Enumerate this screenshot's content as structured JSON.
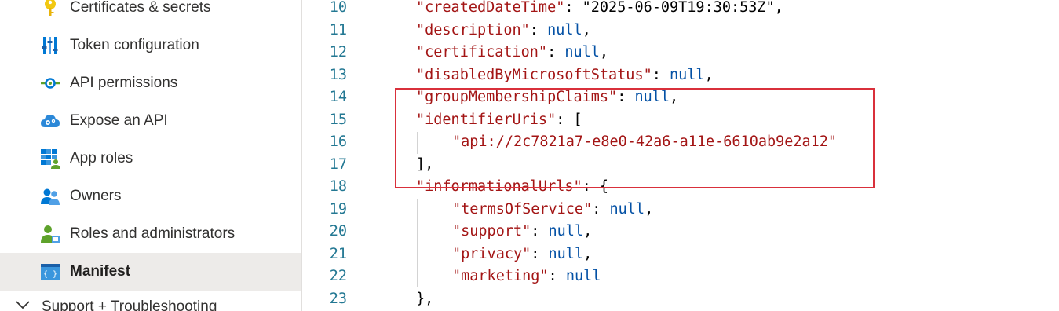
{
  "sidebar": {
    "items": [
      {
        "label": "Certificates & secrets",
        "icon": "key-icon"
      },
      {
        "label": "Token configuration",
        "icon": "token-bars-icon"
      },
      {
        "label": "API permissions",
        "icon": "api-permissions-icon"
      },
      {
        "label": "Expose an API",
        "icon": "cloud-gear-icon"
      },
      {
        "label": "App roles",
        "icon": "app-roles-grid-icon"
      },
      {
        "label": "Owners",
        "icon": "owners-people-icon"
      },
      {
        "label": "Roles and administrators",
        "icon": "roles-admin-icon"
      },
      {
        "label": "Manifest",
        "icon": "manifest-braces-icon",
        "selected": true
      }
    ],
    "section": {
      "label": "Support + Troubleshooting",
      "icon": "chevron-down-icon"
    }
  },
  "editor": {
    "lines": [
      {
        "n": "10",
        "text": "\"createdDateTime\": \"2025-06-09T19:30:53Z\","
      },
      {
        "n": "11",
        "text": "\"description\": null,"
      },
      {
        "n": "12",
        "text": "\"certification\": null,"
      },
      {
        "n": "13",
        "text": "\"disabledByMicrosoftStatus\": null,"
      },
      {
        "n": "14",
        "text": "\"groupMembershipClaims\": null,"
      },
      {
        "n": "15",
        "text": "\"identifierUris\": ["
      },
      {
        "n": "16",
        "text": "\"api://2c7821a7-e8e0-42a6-a11e-6610ab9e2a12\""
      },
      {
        "n": "17",
        "text": "],"
      },
      {
        "n": "18",
        "text": "\"informationalUrls\": {"
      },
      {
        "n": "19",
        "text": "\"termsOfService\": null,"
      },
      {
        "n": "20",
        "text": "\"support\": null,"
      },
      {
        "n": "21",
        "text": "\"privacy\": null,"
      },
      {
        "n": "22",
        "text": "\"marketing\": null"
      },
      {
        "n": "23",
        "text": "},"
      }
    ],
    "highlight_color": "#d9303b"
  }
}
